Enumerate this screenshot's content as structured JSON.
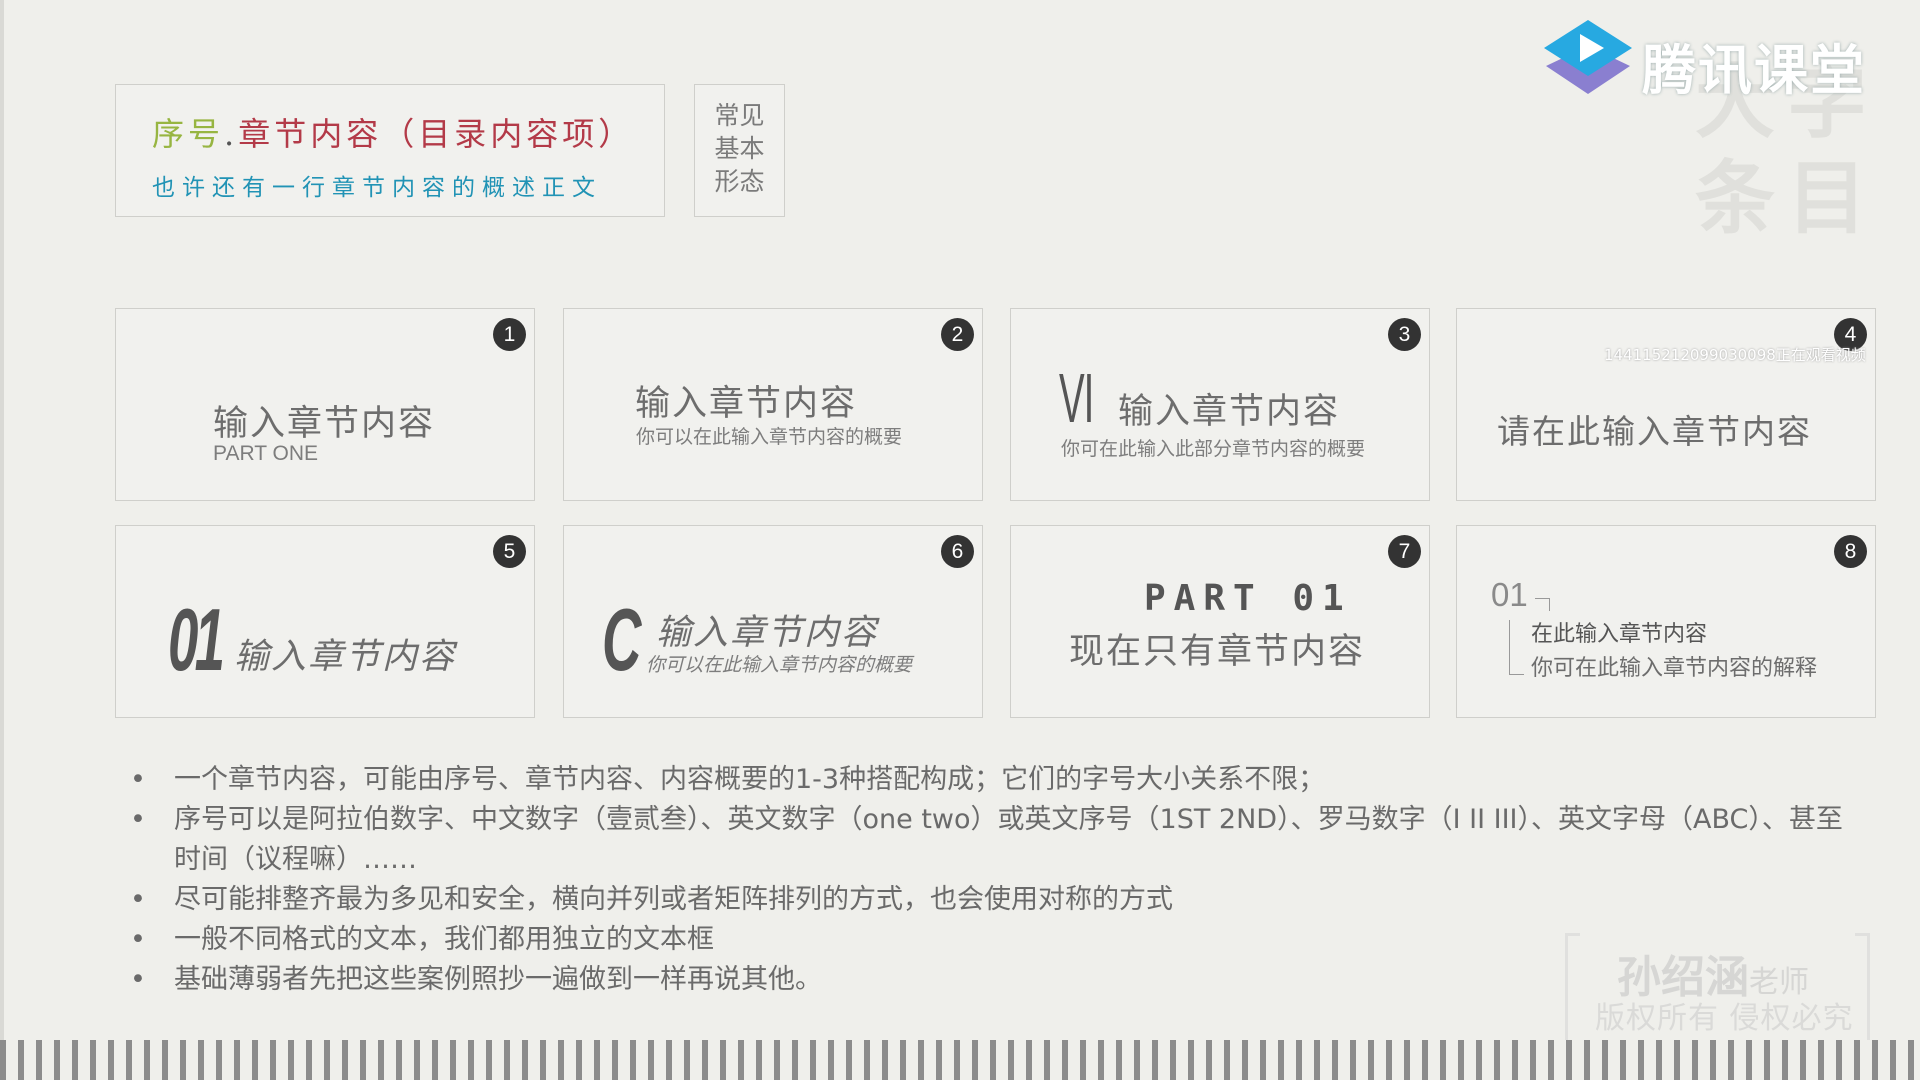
{
  "header_box": {
    "seq": "序号",
    "dot": ".",
    "chapter": "章节内容（目录内容项）",
    "summary": "也许还有一行章节内容的概述正文"
  },
  "form_box": {
    "lines": [
      "常见",
      "基本",
      "形态"
    ]
  },
  "cards": [
    {
      "badge": "1",
      "title": "输入章节内容",
      "sub": "PART ONE"
    },
    {
      "badge": "2",
      "title": "输入章节内容",
      "sub": "你可以在此输入章节内容的概要"
    },
    {
      "badge": "3",
      "numeral": "VI",
      "title": "输入章节内容",
      "sub": "你可在此输入此部分章节内容的概要"
    },
    {
      "badge": "4",
      "title": "请在此输入章节内容"
    },
    {
      "badge": "5",
      "numeral": "01",
      "title": "输入章节内容"
    },
    {
      "badge": "6",
      "numeral": "C",
      "title": "输入章节内容",
      "sub": "你可以在此输入章节内容的概要"
    },
    {
      "badge": "7",
      "part": "PART 01",
      "title": "现在只有章节内容"
    },
    {
      "badge": "8",
      "numeral": "01",
      "title": "在此输入章节内容",
      "sub": "你可在此输入章节内容的解释"
    }
  ],
  "bullets": [
    "一个章节内容，可能由序号、章节内容、内容概要的1-3种搭配构成；它们的字号大小关系不限；",
    "序号可以是阿拉伯数字、中文数字（壹贰叁）、英文数字（one two）或英文序号（1ST 2ND）、罗马数字（I II III）、英文字母（ABC）、甚至时间（议程嘛）……",
    "尽可能排整齐最为多见和安全，横向并列或者矩阵排列的方式，也会使用对称的方式",
    "一般不同格式的文本，我们都用独立的文本框",
    "基础薄弱者先把这些案例照抄一遍做到一样再说其他。"
  ],
  "bullet_symbol": "•",
  "logo": {
    "text": "腾讯课堂",
    "icon": "play-icon",
    "colors": {
      "blue": "#27a9e1",
      "purple": "#8a7fd0"
    }
  },
  "ghost_text": [
    "大字",
    "条目"
  ],
  "watermark_id": "144115212099030098正在观看视频",
  "stamp": {
    "name": "孙绍涵",
    "role": "老师",
    "line2": "版权所有 侵权必究"
  }
}
